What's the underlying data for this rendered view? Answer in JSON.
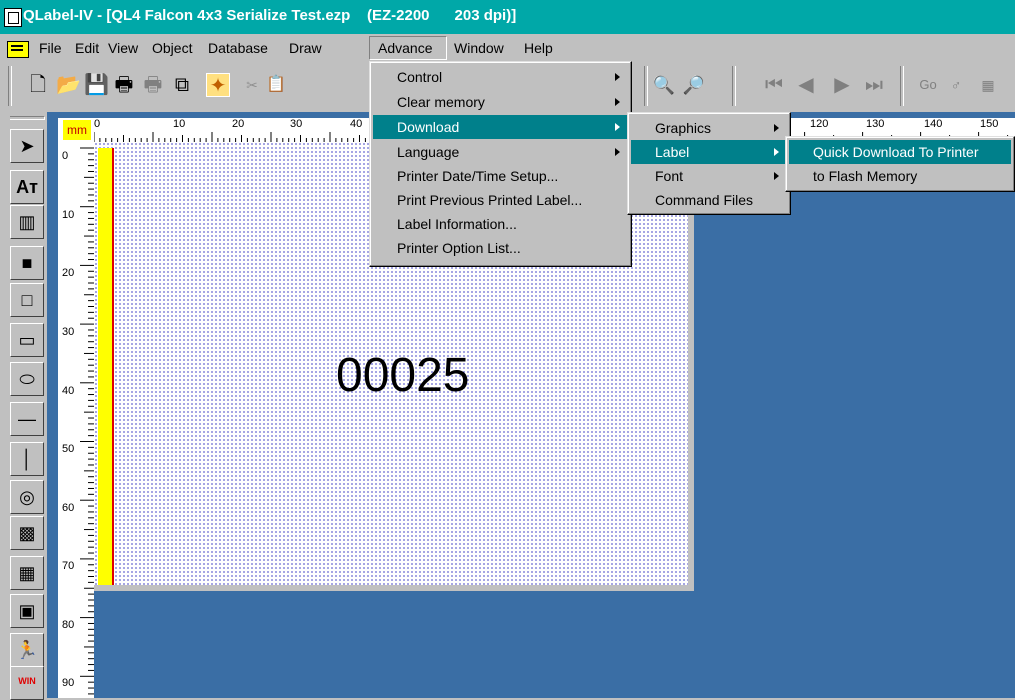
{
  "window": {
    "title": "QLabel-IV - [QL4 Falcon 4x3 Serialize Test.ezp    (EZ-2200      203 dpi)]"
  },
  "menubar": {
    "items": [
      "File",
      "Edit",
      "View",
      "Object",
      "Database",
      "Draw",
      "Advance",
      "Window",
      "Help"
    ]
  },
  "advance_menu": {
    "items": [
      {
        "label": "Control",
        "submenu": true
      },
      {
        "label": "Clear memory",
        "submenu": true
      },
      {
        "label": "Download",
        "submenu": true,
        "selected": true
      },
      {
        "label": "Language",
        "submenu": true
      },
      {
        "label": "Printer Date/Time Setup...",
        "submenu": false
      },
      {
        "label": "Print Previous Printed Label...",
        "submenu": false
      },
      {
        "label": "Label Information...",
        "submenu": false
      },
      {
        "label": "Printer Option List...",
        "submenu": false
      }
    ]
  },
  "download_menu": {
    "items": [
      {
        "label": "Graphics",
        "submenu": true
      },
      {
        "label": "Label",
        "submenu": true,
        "selected": true
      },
      {
        "label": "Font",
        "submenu": true
      },
      {
        "label": "Command Files",
        "submenu": false
      }
    ]
  },
  "label_menu": {
    "items": [
      {
        "label": "Quick Download To Printer",
        "selected": true
      },
      {
        "label": "to Flash Memory"
      }
    ]
  },
  "ruler": {
    "unit": "mm",
    "h_ticks": [
      "0",
      "10",
      "20",
      "30",
      "40",
      "120",
      "130",
      "140",
      "150"
    ],
    "v_ticks": [
      "0",
      "10",
      "20",
      "30",
      "40",
      "50",
      "60",
      "70",
      "80",
      "90"
    ]
  },
  "label": {
    "text": "00025"
  },
  "toolbar": {
    "go_label": "Go"
  },
  "lefttools": {
    "win_label": "WIN"
  },
  "colors": {
    "titlebar": "#00a8a8",
    "menu_highlight": "#00808b",
    "workspace": "#3a6ea5",
    "yellow_bar": "#ffff00"
  }
}
